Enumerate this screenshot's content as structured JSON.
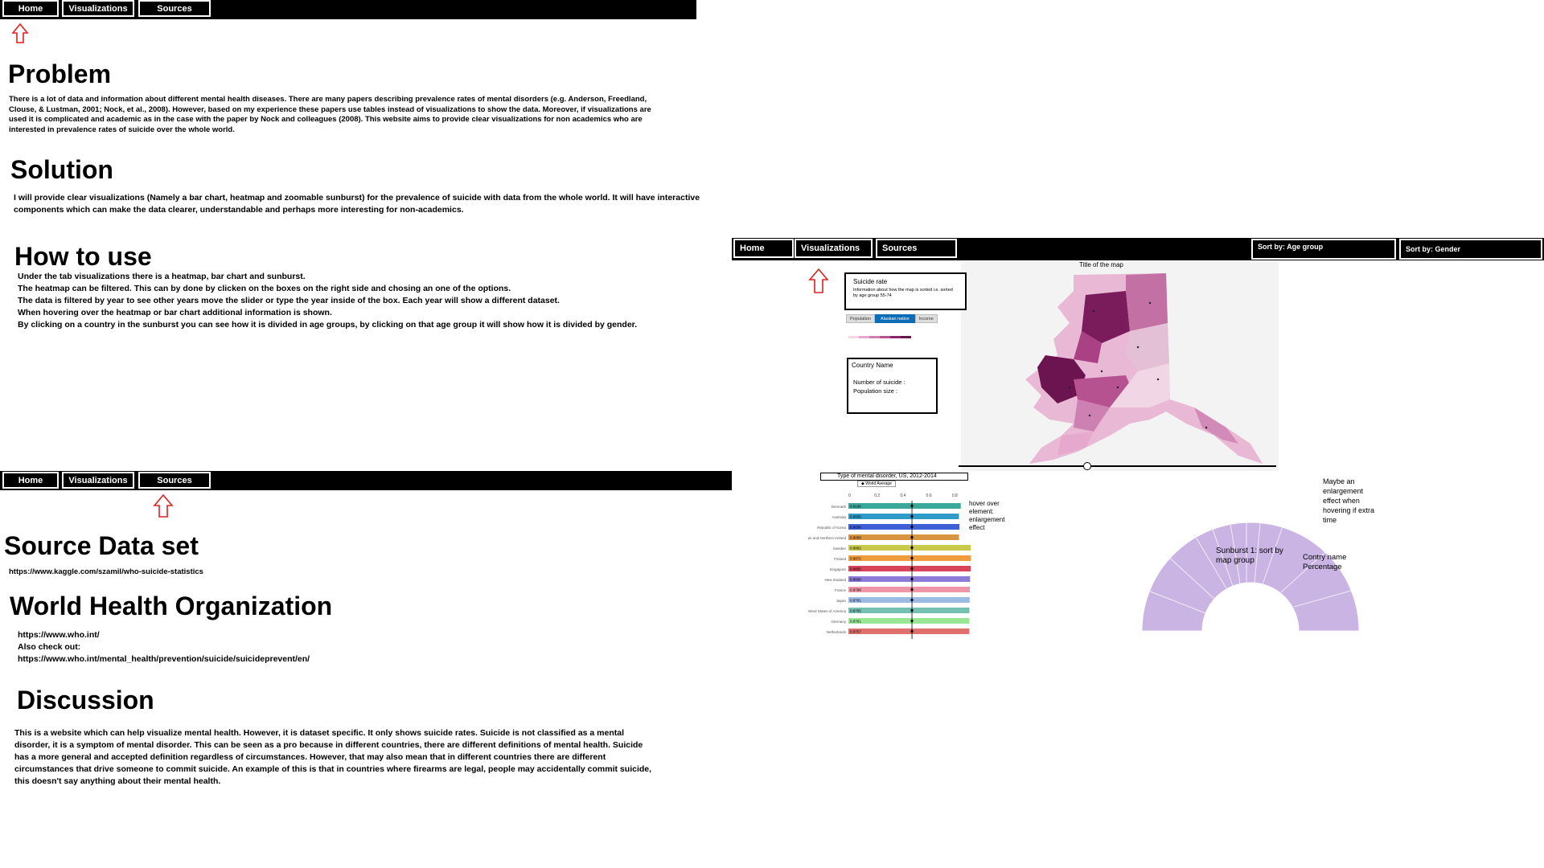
{
  "nav": {
    "home": "Home",
    "visualizations": "Visualizations",
    "sources": "Sources"
  },
  "home_page": {
    "problem_title": "Problem",
    "problem_text": "There is a lot of data and information about different mental health diseases. There are many papers describing prevalence rates of mental disorders (e.g. Anderson, Freedland, Clouse, & Lustman, 2001; Nock, et al., 2008). However, based on my experience these papers use tables instead of visualizations to show the data. Moreover, if visualizations are used it is complicated and academic as in the case with the paper by Nock and colleagues (2008). This website aims to provide clear visualizations for non academics who are interested in prevalence rates of suicide over the whole world.",
    "solution_title": "Solution",
    "solution_text": "I will provide clear visualizations (Namely a bar chart, heatmap and zoomable sunburst) for the prevalence of suicide with data from the whole world. It will have interactive components which can make the data clearer, understandable and perhaps more interesting for non-academics.",
    "how_title": "How to use",
    "how_lines": [
      "Under the tab visualizations there is a heatmap, bar chart and sunburst.",
      "The heatmap can be filtered. This can by done by clicken on the boxes on the right side and chosing an one of the options.",
      "The data is filtered by year to see other years move the slider or type the year inside of the box. Each year will show a different dataset.",
      "When hovering over the heatmap or bar chart additional information is shown.",
      "By clicking on a country in the sunburst you can see how it is divided in age groups, by clicking on that age group it will show how it is divided by gender."
    ]
  },
  "sources_page": {
    "source_title": "Source Data set",
    "source_url": "https://www.kaggle.com/szamil/who-suicide-statistics",
    "who_title": "World Health Organization",
    "who_url": "https://www.who.int/",
    "also": "Also check out:",
    "who_url2": "https://www.who.int/mental_health/prevention/suicide/suicideprevent/en/",
    "discussion_title": "Discussion",
    "discussion_text": "This is a website which can help visualize mental health. However, it is dataset specific. It only shows suicide rates. Suicide is not classified as a mental disorder, it is a symptom of mental disorder. This can be seen as a pro because in different countries, there are different definitions of mental health. Suicide has a more general and accepted definition regardless of circumstances. However, that may also mean that in different countries there are different circumstances that drive someone to commit suicide. An example of this is that in countries where firearms are legal, people may accidentally commit suicide, this doesn't say anything about their mental health."
  },
  "viz_page": {
    "sort_age": "Sort by:  Age group",
    "sort_gender": "Sort by: Gender",
    "map_title": "Title of the map",
    "suicide_rate": "Suicide rate",
    "suicide_info": "Information about how the map is sorted i.e. sorted by age group 55-74",
    "tabs": [
      "Population",
      "Alaskan native",
      "Income"
    ],
    "country_name": "Country Name",
    "num_suicide": "Number of suicide :",
    "pop_size": "Population size :",
    "chart_title": "Type of mental disorder, US, 2012-2014",
    "world_average": "World Average",
    "hover_note": "hover over element: enlargement effect",
    "sunburst_center": "Sunburst 1: sort by map group",
    "sunburst_label": "Contry name Percentage",
    "sunburst_note": "Maybe an enlargement effect when hovering if extra time",
    "accent": "#0b6db6"
  },
  "chart_data": {
    "type": "bar",
    "categories": [
      "Denmark",
      "Australia",
      "Republic of Korea",
      "United Kingdom of Great Britain and Northern Ireland",
      "Sweden",
      "Finland",
      "Singapore",
      "New Zealand",
      "France",
      "Japan",
      "United States of America",
      "Germany",
      "Netherlands"
    ],
    "values": [
      0.8136,
      0.8005,
      0.8036,
      0.8008,
      0.8862,
      0.8872,
      0.8855,
      0.8809,
      0.8798,
      0.8781,
      0.8765,
      0.8761,
      0.8757
    ],
    "value_labels": [
      "0.8136",
      "0.8005",
      "0.8036",
      "0.8008",
      "0.8862",
      "0.8872",
      "0.8855",
      "0.8809",
      "0.8798",
      "0.8781",
      "0.8765",
      "0.8761",
      "0.8757"
    ],
    "colors": [
      "#3aa89a",
      "#2f9bc9",
      "#3f5fd6",
      "#d99442",
      "#c9c94b",
      "#ef9c3d",
      "#d9445a",
      "#8e7ad8",
      "#ef95a8",
      "#9bbbe4",
      "#74c1b2",
      "#99e695",
      "#e0706e"
    ],
    "title": "Type of mental disorder, US, 2012-2014",
    "xlim": [
      0,
      1
    ],
    "ticks": [
      "0",
      "0.2",
      "0.4",
      "0.6",
      "0.8"
    ]
  }
}
